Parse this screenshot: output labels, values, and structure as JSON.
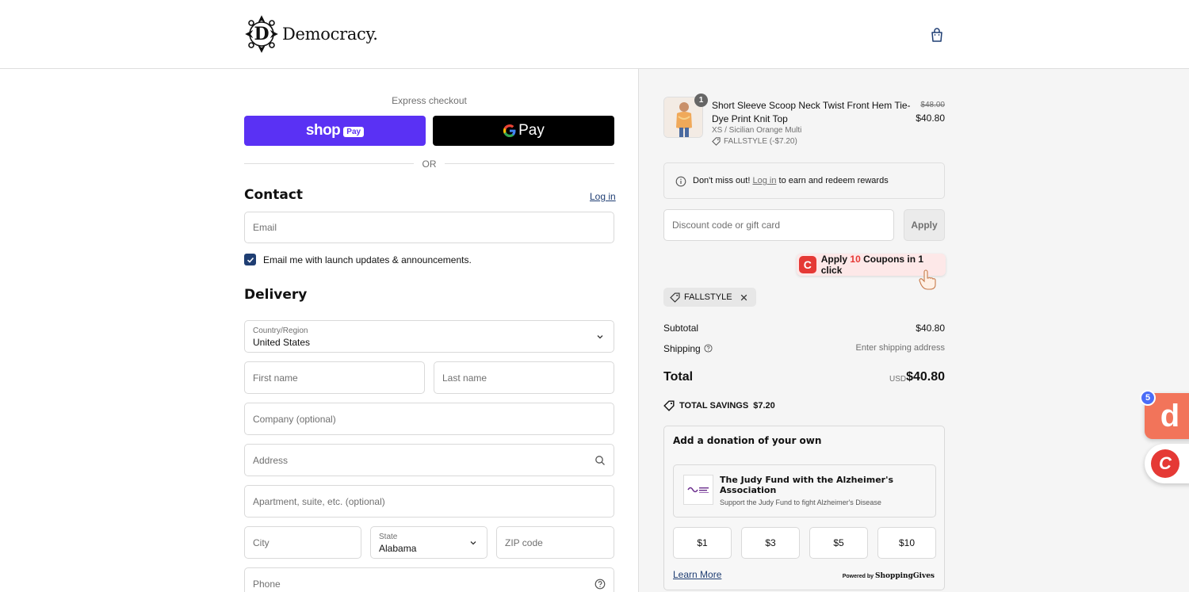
{
  "brand": {
    "name": "Democracy."
  },
  "express": {
    "label": "Express checkout",
    "shop_pay_word": "shop",
    "shop_pay_pill": "Pay",
    "gpay_g": "G",
    "gpay_word": "Pay",
    "or_label": "OR"
  },
  "contact": {
    "title": "Contact",
    "login_link": "Log in",
    "email_placeholder": "Email",
    "newsletter_label": "Email me with launch updates & announcements.",
    "newsletter_checked": true
  },
  "delivery": {
    "title": "Delivery",
    "country_label": "Country/Region",
    "country_value": "United States",
    "first_name_placeholder": "First name",
    "last_name_placeholder": "Last name",
    "company_placeholder": "Company (optional)",
    "address_placeholder": "Address",
    "apartment_placeholder": "Apartment, suite, etc. (optional)",
    "city_placeholder": "City",
    "state_label": "State",
    "state_value": "Alabama",
    "zip_placeholder": "ZIP code",
    "phone_placeholder": "Phone"
  },
  "order": {
    "product": {
      "quantity": "1",
      "name": "Short Sleeve Scoop Neck Twist Front Hem Tie-Dye Print Knit Top",
      "variant": "XS / Sicilian Orange Multi",
      "discount": "FALLSTYLE (-$7.20)",
      "price_original": "$48.00",
      "price": "$40.80"
    },
    "rewards": {
      "prefix": "Don't miss out!",
      "link": "Log in",
      "suffix": "to earn and redeem rewards"
    },
    "discount_placeholder": "Discount code or gift card",
    "apply_label": "Apply",
    "coupon": {
      "prefix": "Apply",
      "count": "10",
      "suffix": "Coupons in 1 click",
      "logo_letter": "C"
    },
    "applied_code": "FALLSTYLE",
    "subtotal_label": "Subtotal",
    "subtotal_value": "$40.80",
    "shipping_label": "Shipping",
    "shipping_value": "Enter shipping address",
    "total_label": "Total",
    "total_currency": "USD",
    "total_value": "$40.80",
    "savings_label": "TOTAL SAVINGS",
    "savings_value": "$7.20"
  },
  "donation": {
    "title": "Add a donation of your own",
    "charity_name": "The Judy Fund with the Alzheimer's Association",
    "charity_description": "Support the Judy Fund to fight Alzheimer's Disease",
    "amounts": [
      "$1",
      "$3",
      "$5",
      "$10"
    ],
    "learn_more": "Learn More",
    "powered_prefix": "Powered by",
    "powered_brand": "ShoppingGives"
  },
  "extensions": {
    "d_letter": "d",
    "d_badge": "5",
    "c_letter": "C"
  },
  "colors": {
    "shop_pay": "#5a31f4",
    "link": "#1f3e73",
    "coupon_red": "#e53935",
    "summary_bg": "#f5f5f5"
  }
}
